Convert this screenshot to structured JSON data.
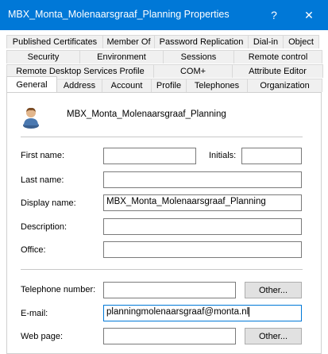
{
  "window": {
    "title": "MBX_Monta_Molenaarsgraaf_Planning Properties",
    "help_glyph": "?",
    "close_glyph": "✕"
  },
  "tabs": {
    "row1": [
      "Published Certificates",
      "Member Of",
      "Password Replication",
      "Dial-in",
      "Object"
    ],
    "row2": [
      "Security",
      "Environment",
      "Sessions",
      "Remote control"
    ],
    "row3": [
      "Remote Desktop Services Profile",
      "COM+",
      "Attribute Editor"
    ],
    "row4": [
      "General",
      "Address",
      "Account",
      "Profile",
      "Telephones",
      "Organization"
    ],
    "active": "General"
  },
  "general": {
    "header_name": "MBX_Monta_Molenaarsgraaf_Planning",
    "avatar_icon": "user-icon",
    "first_name": {
      "label": "First name:",
      "value": ""
    },
    "initials": {
      "label": "Initials:",
      "value": ""
    },
    "last_name": {
      "label": "Last name:",
      "value": ""
    },
    "display_name": {
      "label": "Display name:",
      "value": "MBX_Monta_Molenaarsgraaf_Planning"
    },
    "description": {
      "label": "Description:",
      "value": ""
    },
    "office": {
      "label": "Office:",
      "value": ""
    },
    "telephone": {
      "label": "Telephone number:",
      "value": "",
      "other_label": "Other..."
    },
    "email": {
      "label": "E-mail:",
      "value": "planningmolenaarsgraaf@monta.nl"
    },
    "web_page": {
      "label": "Web page:",
      "value": "",
      "other_label": "Other..."
    }
  },
  "colors": {
    "titlebar": "#0078d7",
    "focus": "#0078d7"
  }
}
